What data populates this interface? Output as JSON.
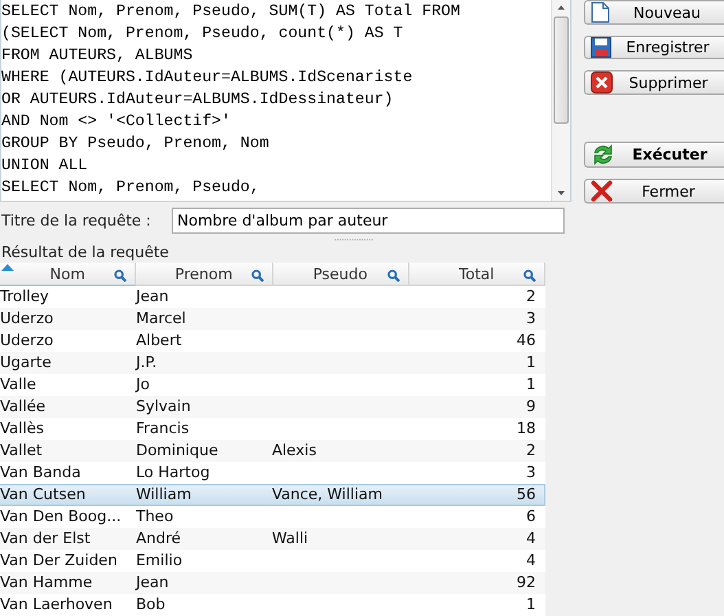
{
  "query_editor": {
    "lines": [
      "SELECT Nom, Prenom, Pseudo, SUM(T) AS Total FROM",
      "(SELECT Nom, Prenom, Pseudo, count(*) AS T",
      "FROM AUTEURS, ALBUMS",
      "WHERE (AUTEURS.IdAuteur=ALBUMS.IdScenariste",
      "OR AUTEURS.IdAuteur=ALBUMS.IdDessinateur)",
      "AND Nom <> '<Collectif>'",
      "GROUP BY Pseudo, Prenom, Nom",
      "UNION ALL",
      "SELECT Nom, Prenom, Pseudo,"
    ]
  },
  "buttons": [
    {
      "label": "Nouveau",
      "kind": "new",
      "bold": false
    },
    {
      "label": "Enregistrer",
      "kind": "save",
      "bold": false
    },
    {
      "label": "Supprimer",
      "kind": "delete",
      "bold": false
    },
    {
      "label": "Exécuter",
      "kind": "run",
      "bold": true
    },
    {
      "label": "Fermer",
      "kind": "close",
      "bold": false
    }
  ],
  "title_field": {
    "label": "Titre de la requête :",
    "value": "Nombre d'album par auteur"
  },
  "result_label": "Résultat de la requête",
  "table": {
    "columns": [
      {
        "label": "Nom",
        "sorted": true
      },
      {
        "label": "Prenom",
        "sorted": false
      },
      {
        "label": "Pseudo",
        "sorted": false
      },
      {
        "label": "Total",
        "sorted": false
      }
    ],
    "rows": [
      {
        "cells": [
          "Trolley",
          "Jean",
          "",
          "2"
        ],
        "selected": false
      },
      {
        "cells": [
          "Uderzo",
          "Marcel",
          "",
          "3"
        ],
        "selected": false
      },
      {
        "cells": [
          "Uderzo",
          "Albert",
          "",
          "46"
        ],
        "selected": false
      },
      {
        "cells": [
          "Ugarte",
          "J.P.",
          "",
          "1"
        ],
        "selected": false
      },
      {
        "cells": [
          "Valle",
          "Jo",
          "",
          "1"
        ],
        "selected": false
      },
      {
        "cells": [
          "Vallée",
          "Sylvain",
          "",
          "9"
        ],
        "selected": false
      },
      {
        "cells": [
          "Vallès",
          "Francis",
          "",
          "18"
        ],
        "selected": false
      },
      {
        "cells": [
          "Vallet",
          "Dominique",
          "Alexis",
          "2"
        ],
        "selected": false
      },
      {
        "cells": [
          "Van Banda",
          "Lo Hartog",
          "",
          "3"
        ],
        "selected": false
      },
      {
        "cells": [
          "Van Cutsen",
          "William",
          "Vance, William",
          "56"
        ],
        "selected": true
      },
      {
        "cells": [
          "Van Den Boog...",
          "Theo",
          "",
          "6"
        ],
        "selected": false
      },
      {
        "cells": [
          "Van der Elst",
          "André",
          "Walli",
          "4"
        ],
        "selected": false
      },
      {
        "cells": [
          "Van Der Zuiden",
          "Emilio",
          "",
          "4"
        ],
        "selected": false
      },
      {
        "cells": [
          "Van Hamme",
          "Jean",
          "",
          "92"
        ],
        "selected": false
      },
      {
        "cells": [
          "Van Laerhoven",
          "Bob",
          "",
          "1"
        ],
        "selected": false
      }
    ]
  }
}
